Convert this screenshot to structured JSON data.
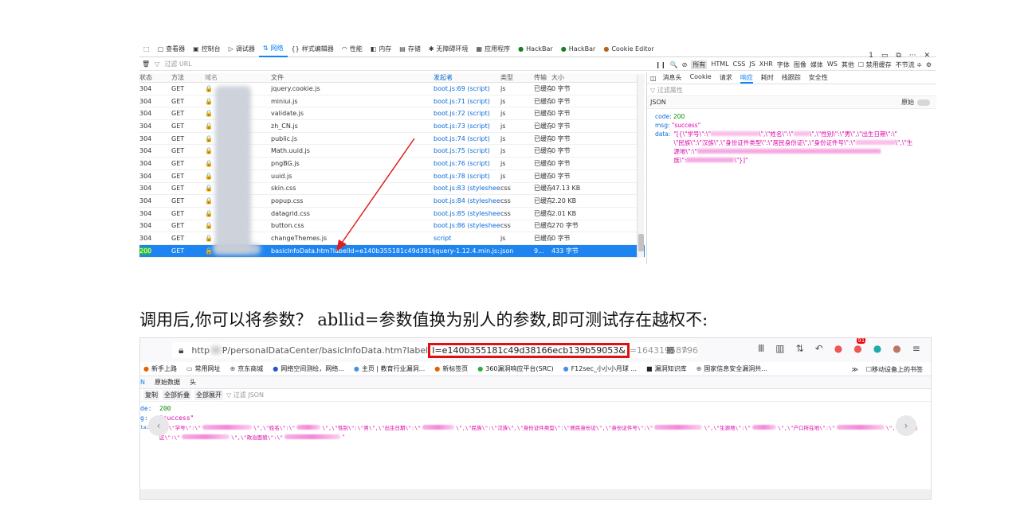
{
  "devtools": {
    "tabs": [
      {
        "label": "查看器",
        "icon": "inspector-icon"
      },
      {
        "label": "控制台",
        "icon": "console-icon"
      },
      {
        "label": "调试器",
        "icon": "debugger-icon"
      },
      {
        "label": "网络",
        "icon": "network-icon",
        "active": true
      },
      {
        "label": "样式编辑器",
        "icon": "style-editor-icon"
      },
      {
        "label": "性能",
        "icon": "performance-icon"
      },
      {
        "label": "内存",
        "icon": "memory-icon"
      },
      {
        "label": "存储",
        "icon": "storage-icon"
      },
      {
        "label": "无障碍环境",
        "icon": "accessibility-icon"
      },
      {
        "label": "应用程序",
        "icon": "application-icon"
      },
      {
        "label": "HackBar",
        "icon": "hackbar-icon"
      },
      {
        "label": "HackBar",
        "icon": "hackbar-icon"
      },
      {
        "label": "Cookie Editor",
        "icon": "cookie-icon"
      }
    ],
    "right_controls": {
      "count": "1",
      "more": "···",
      "close": "✕"
    },
    "filter": {
      "placeholder": "过滤 URL",
      "types": [
        "所有",
        "HTML",
        "CSS",
        "JS",
        "XHR",
        "字体",
        "图像",
        "媒体",
        "WS",
        "其他"
      ],
      "active_type": "所有",
      "disable_cache": "禁用缓存",
      "throttle": "不节流 ≑"
    },
    "columns": [
      "状态",
      "方法",
      "域名",
      "文件",
      "发起者",
      "类型",
      "传输",
      "大小"
    ],
    "rows": [
      {
        "status": "304",
        "method": "GET",
        "file": "jquery.cookie.js",
        "initiator": "boot.js:69 (script)",
        "type": "js",
        "transfer": "已缓存",
        "size": "0 字节"
      },
      {
        "status": "304",
        "method": "GET",
        "file": "miniui.js",
        "initiator": "boot.js:71 (script)",
        "type": "js",
        "transfer": "已缓存",
        "size": "0 字节"
      },
      {
        "status": "304",
        "method": "GET",
        "file": "validate.js",
        "initiator": "boot.js:72 (script)",
        "type": "js",
        "transfer": "已缓存",
        "size": "0 字节"
      },
      {
        "status": "304",
        "method": "GET",
        "file": "zh_CN.js",
        "initiator": "boot.js:73 (script)",
        "type": "js",
        "transfer": "已缓存",
        "size": "0 字节"
      },
      {
        "status": "304",
        "method": "GET",
        "file": "public.js",
        "initiator": "boot.js:74 (script)",
        "type": "js",
        "transfer": "已缓存",
        "size": "0 字节"
      },
      {
        "status": "304",
        "method": "GET",
        "file": "Math.uuid.js",
        "initiator": "boot.js:75 (script)",
        "type": "js",
        "transfer": "已缓存",
        "size": "0 字节"
      },
      {
        "status": "304",
        "method": "GET",
        "file": "pngBG.js",
        "initiator": "boot.js:76 (script)",
        "type": "js",
        "transfer": "已缓存",
        "size": "0 字节"
      },
      {
        "status": "304",
        "method": "GET",
        "file": "uuid.js",
        "initiator": "boot.js:78 (script)",
        "type": "js",
        "transfer": "已缓存",
        "size": "0 字节"
      },
      {
        "status": "304",
        "method": "GET",
        "file": "skin.css",
        "initiator": "boot.js:83 (stylesheet)",
        "type": "css",
        "transfer": "已缓存",
        "size": "47.13 KB"
      },
      {
        "status": "304",
        "method": "GET",
        "file": "popup.css",
        "initiator": "boot.js:84 (stylesheet)",
        "type": "css",
        "transfer": "已缓存",
        "size": "2.20 KB"
      },
      {
        "status": "304",
        "method": "GET",
        "file": "datagrid.css",
        "initiator": "boot.js:85 (stylesheet)",
        "type": "css",
        "transfer": "已缓存",
        "size": "2.01 KB"
      },
      {
        "status": "304",
        "method": "GET",
        "file": "button.css",
        "initiator": "boot.js:86 (stylesheet)",
        "type": "css",
        "transfer": "已缓存",
        "size": "270 字节"
      },
      {
        "status": "304",
        "method": "GET",
        "file": "changeThemes.js",
        "initiator": "script",
        "type": "js",
        "transfer": "已缓存",
        "size": "0 字节"
      },
      {
        "status": "200",
        "method": "GET",
        "file": "basicInfoData.htm?labelId=e140b355181c49d38166ec613",
        "initiator": "jquery-1.12.4.min.js:...",
        "type": "json",
        "transfer": "9...",
        "size": "433 字节",
        "selected": true
      }
    ],
    "response_tabs": [
      "消息头",
      "Cookie",
      "请求",
      "响应",
      "耗时",
      "栈跟踪",
      "安全性"
    ],
    "active_response_tab": "响应",
    "response_filter_placeholder": "过滤属性",
    "response_json_label": "JSON",
    "raw_toggle_label": "原始",
    "response": {
      "code_key": "code:",
      "code_value": "200",
      "msg_key": "msg:",
      "msg_value": "\"success\"",
      "data_key": "data:",
      "data_visible": "\"[{\\\"学号\\\":\\\"",
      "data_mid1": "\\\",\\\"姓名\\\":\\\"",
      "data_mid2": "\\\",\\\"性别\\\":\\\"男\\\",\\\"出生日期\\\":\\\"",
      "data_l2": "\\\"民族\\\":\\\"汉族\\\",\\\"身份证件类型\\\":\\\"居民身份证\\\",\\\"身份证件号\\\":\\\"",
      "data_l2b": "\\\",\\\"生",
      "data_l3": "源地\\\":\\\"",
      "data_l4": "族\\\":",
      "data_end": "\\\"}]\""
    }
  },
  "caption": "调用后,你可以将参数？ abllid=参数值换为别人的参数,即可测试存在越权不:",
  "browser": {
    "url_prefix": "http",
    "url_path": "P/personalDataCenter/basicInfoData.htm?label",
    "url_highlight": "I=e140b355181c49d38166ecb139b59053&",
    "url_tail": "=16431958796",
    "bookmarks": [
      {
        "label": "新手上路",
        "icon": "firefox-icon"
      },
      {
        "label": "常用网址",
        "icon": "folder-icon"
      },
      {
        "label": "京东商城",
        "icon": "globe-icon"
      },
      {
        "label": "网络空间测绘，网络...",
        "icon": "fofa-icon"
      },
      {
        "label": "主页 | 教育行业漏洞...",
        "icon": "edu-icon"
      },
      {
        "label": "新标签页",
        "icon": "firefox-icon"
      },
      {
        "label": "360漏洞响应平台(SRC)",
        "icon": "360-icon"
      },
      {
        "label": "F12sec_小小小月球 ...",
        "icon": "f12-icon"
      },
      {
        "label": "漏洞知识库",
        "icon": "vuln-kb-icon"
      },
      {
        "label": "国家信息安全漏洞共...",
        "icon": "globe-icon"
      }
    ],
    "bookmarks_more": "≫",
    "mobile_bookmarks": "移动设备上的书签",
    "json_tabs": [
      "N",
      "原始数据",
      "头"
    ],
    "json_tools": [
      "复制",
      "全部折叠",
      "全部展开"
    ],
    "json_filter_placeholder": "过滤 JSON",
    "body": {
      "code_key": "de:",
      "code_value": "200",
      "msg_key": "g:",
      "msg_value": "\"success\"",
      "data_key": "ta:",
      "line1": [
        "\"[{\\\"学号\\\":\\\"",
        "\\\",\\\"姓名\\\":\\\"",
        "\\\",\\\"性别\\\":\\\"男\\\",\\\"出生日期\\\":\\\"",
        "\\\",\\\"民族\\\":\\\"汉族\\\",\\\"身份证件类型\\\":\\\"居民身份证\\\",\\\"身份证件号\\\":\\\"",
        "\\\",\\\"生源地\\\":\\\"",
        "\\\",\\\"户口所在地\\\":\\\"",
        "\\\",\\\"国家地"
      ],
      "line2": [
        "区\\\":\\\"",
        "\\\",\\\"政治面貌\\\":\\\"",
        "\""
      ]
    },
    "notification_badge": "91"
  },
  "colors": {
    "accent": "#0a84ff",
    "selected_row": "#1e85f0",
    "json_string": "#dd00a9",
    "json_number": "#058b00",
    "highlight_box": "#e01010"
  }
}
